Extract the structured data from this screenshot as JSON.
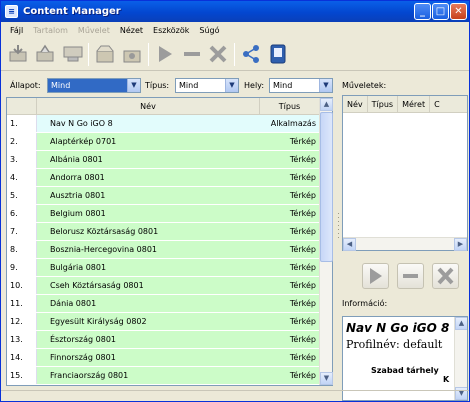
{
  "window": {
    "title": "Content Manager",
    "app_icon": "cm-app-icon"
  },
  "menu": [
    {
      "label": "Fájl",
      "enabled": true
    },
    {
      "label": "Tartalom",
      "enabled": false
    },
    {
      "label": "Művelet",
      "enabled": false
    },
    {
      "label": "Nézet",
      "enabled": true
    },
    {
      "label": "Eszközök",
      "enabled": true
    },
    {
      "label": "Súgó",
      "enabled": true
    }
  ],
  "filters": {
    "allapot_label": "Állapot:",
    "allapot_value": "Mind",
    "tipus_label": "Típus:",
    "tipus_value": "Mind",
    "hely_label": "Hely:",
    "hely_value": "Mind"
  },
  "list": {
    "headers": {
      "nev": "Név",
      "tipus": "Típus"
    },
    "rows": [
      {
        "num": "1.",
        "name": "Nav N Go iGO 8",
        "type": "Alkalmazás"
      },
      {
        "num": "2.",
        "name": "Alaptérkép 0701",
        "type": "Térkép"
      },
      {
        "num": "3.",
        "name": "Albánia 0801",
        "type": "Térkép"
      },
      {
        "num": "4.",
        "name": "Andorra 0801",
        "type": "Térkép"
      },
      {
        "num": "5.",
        "name": "Ausztria 0801",
        "type": "Térkép"
      },
      {
        "num": "6.",
        "name": "Belgium 0801",
        "type": "Térkép"
      },
      {
        "num": "7.",
        "name": "Belorusz Köztársaság 0801",
        "type": "Térkép"
      },
      {
        "num": "8.",
        "name": "Bosznia-Hercegovina 0801",
        "type": "Térkép"
      },
      {
        "num": "9.",
        "name": "Bulgária 0801",
        "type": "Térkép"
      },
      {
        "num": "10.",
        "name": "Cseh Köztársaság 0801",
        "type": "Térkép"
      },
      {
        "num": "11.",
        "name": "Dánia 0801",
        "type": "Térkép"
      },
      {
        "num": "12.",
        "name": "Egyesült Királyság 0802",
        "type": "Térkép"
      },
      {
        "num": "13.",
        "name": "Észtország 0801",
        "type": "Térkép"
      },
      {
        "num": "14.",
        "name": "Finnország 0801",
        "type": "Térkép"
      },
      {
        "num": "15.",
        "name": "Franciaország 0801",
        "type": "Térkép"
      }
    ]
  },
  "operations": {
    "label": "Műveletek:",
    "headers": [
      "Név",
      "Típus",
      "Méret",
      "C"
    ]
  },
  "info": {
    "label": "Információ:",
    "title": "Nav N Go iGO 8",
    "profile": "Profilnév: default",
    "free_space": "Szabad tárhely",
    "k_text": "K"
  },
  "colors": {
    "selected_row": "#e2fcfc",
    "map_row": "#ccfcc8",
    "titlebar": "#0a5fe8"
  }
}
